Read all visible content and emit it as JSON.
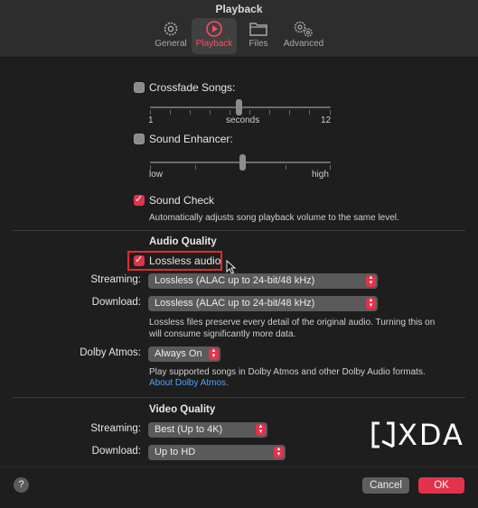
{
  "window": {
    "title": "Playback"
  },
  "tabs": [
    {
      "label": "General",
      "icon": "gear-icon"
    },
    {
      "label": "Playback",
      "icon": "play-icon"
    },
    {
      "label": "Files",
      "icon": "folder-icon"
    },
    {
      "label": "Advanced",
      "icon": "gears-icon"
    }
  ],
  "crossfade": {
    "label": "Crossfade Songs:",
    "checked": false,
    "min_label": "1",
    "mid_label": "seconds",
    "max_label": "12"
  },
  "enhancer": {
    "label": "Sound Enhancer:",
    "checked": false,
    "low_label": "low",
    "high_label": "high"
  },
  "soundcheck": {
    "label": "Sound Check",
    "checked": true,
    "description": "Automatically adjusts song playback volume to the same level."
  },
  "audio_quality": {
    "heading": "Audio Quality",
    "lossless_label": "Lossless audio",
    "lossless_checked": true,
    "streaming_label": "Streaming:",
    "streaming_value": "Lossless (ALAC up to 24-bit/48 kHz)",
    "download_label": "Download:",
    "download_value": "Lossless (ALAC up to 24-bit/48 kHz)",
    "note_line1": "Lossless files preserve every detail of the original audio. Turning this on",
    "note_line2": "will consume significantly more data.",
    "atmos_label": "Dolby Atmos:",
    "atmos_value": "Always On",
    "atmos_note": "Play supported songs in Dolby Atmos and other Dolby Audio formats.",
    "atmos_link": "About Dolby Atmos."
  },
  "video_quality": {
    "heading": "Video Quality",
    "streaming_label": "Streaming:",
    "streaming_value": "Best (Up to 4K)",
    "download_label": "Download:",
    "download_value": "Up to HD"
  },
  "watermark": "XDA",
  "footer": {
    "help": "?",
    "cancel": "Cancel",
    "ok": "OK"
  },
  "colors": {
    "accent": "#e2334b",
    "background": "#1e1e1e",
    "highlight_box": "#e22b2b",
    "link": "#4aa3ff"
  }
}
